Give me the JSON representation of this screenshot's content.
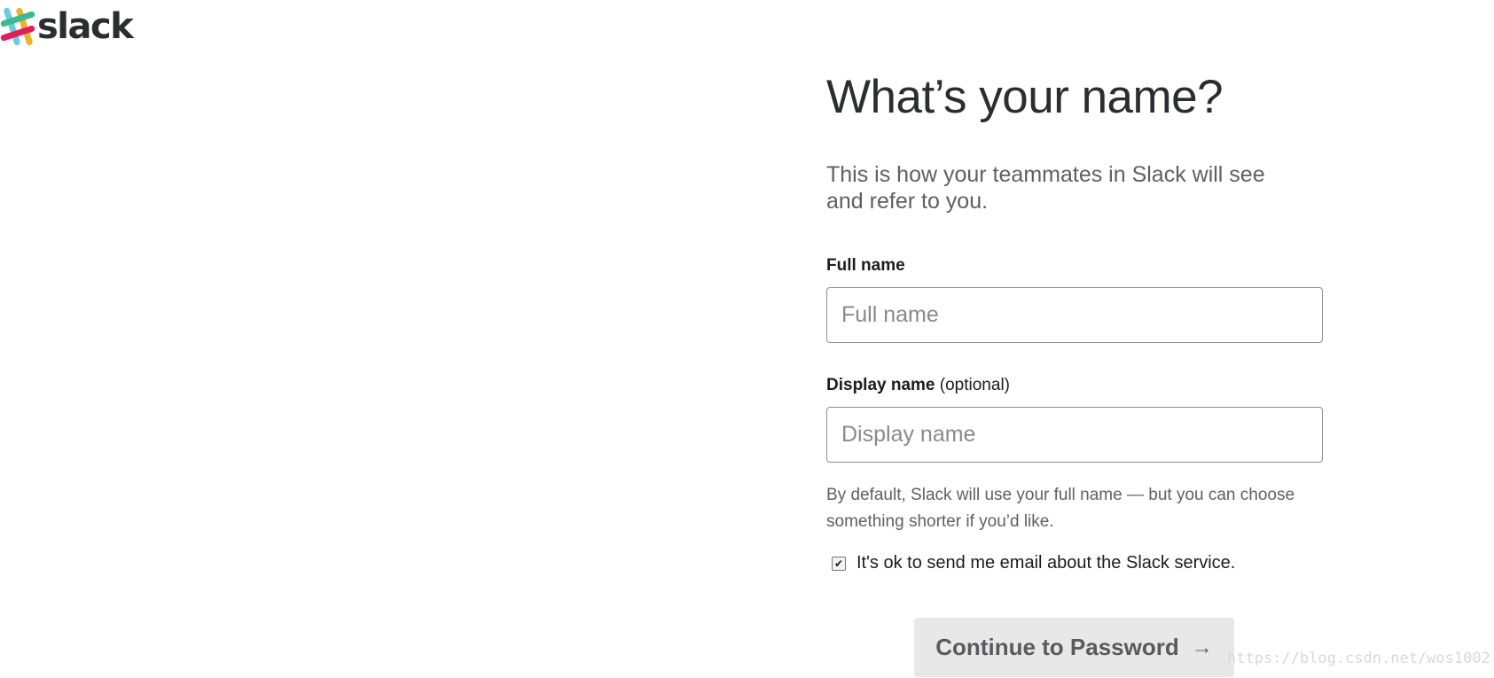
{
  "brand": {
    "wordmark": "slack",
    "logo_icon": "slack-hash-logo-icon",
    "colors": [
      "#36c5ab",
      "#e01e5a",
      "#ecb22e",
      "#6ecadc",
      "#3eb991"
    ]
  },
  "form": {
    "title": "What’s your name?",
    "subtitle": "This is how your teammates in Slack will see and refer to you.",
    "full_name": {
      "label": "Full name",
      "placeholder": "Full name",
      "value": ""
    },
    "display_name": {
      "label": "Display name",
      "optional": "(optional)",
      "placeholder": "Display name",
      "value": ""
    },
    "hint": "By default, Slack will use your full name — but you can choose something shorter if you’d like.",
    "email_opt_in": {
      "label": "It's ok to send me email about the Slack service.",
      "checked": true,
      "check_glyph": "✔"
    },
    "submit": {
      "label": "Continue to Password",
      "icon": "arrow-right-icon",
      "icon_glyph": "→"
    }
  },
  "watermark": "https://blog.csdn.net/wos1002"
}
